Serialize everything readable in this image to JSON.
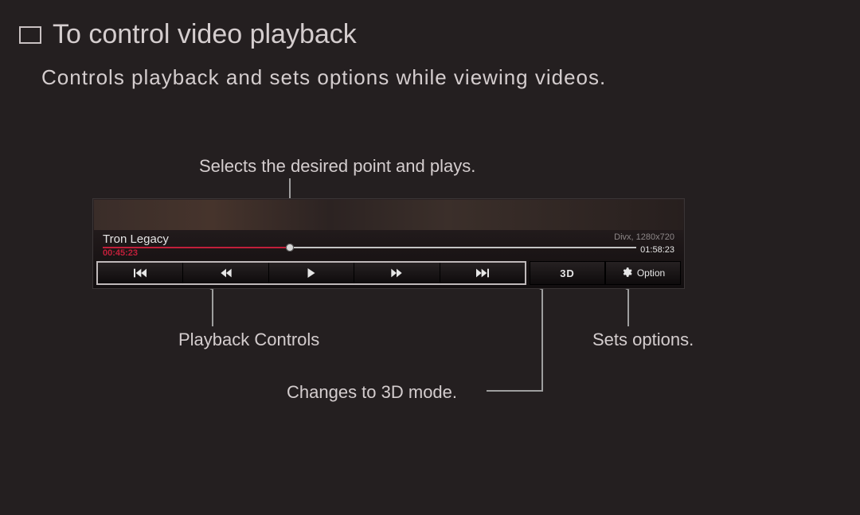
{
  "heading": "To control video playback",
  "subtitle": "Controls playback and sets options while viewing videos.",
  "callouts": {
    "progress": "Selects the desired point and plays.",
    "playback_controls": "Playback Controls",
    "three_d": "Changes to 3D mode.",
    "options": "Sets options."
  },
  "player": {
    "title": "Tron Legacy",
    "current_time": "00:45:23",
    "total_time": "01:58:23",
    "meta": "Divx, 1280x720",
    "three_d_label": "3D",
    "option_label": "Option"
  }
}
